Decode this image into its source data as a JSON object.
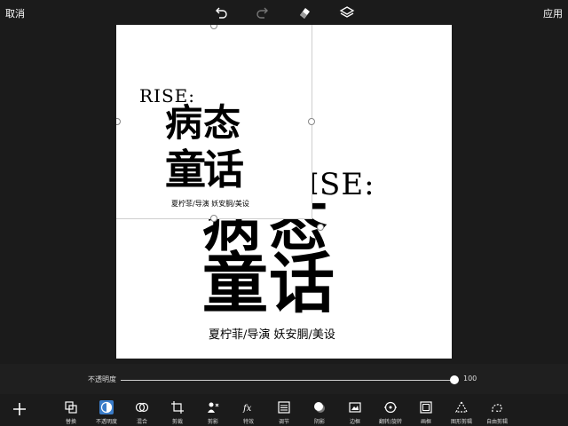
{
  "topbar": {
    "cancel_label": "取消",
    "apply_label": "应用",
    "icons": [
      "undo-icon",
      "redo-icon",
      "eraser-icon",
      "layers-icon"
    ]
  },
  "artwork": {
    "rise": "RISE:",
    "char1": "病",
    "char2": "态",
    "char3": "童",
    "char4": "话",
    "credit": "夏柠菲/导演   妖安胴/美设"
  },
  "opacity": {
    "label": "不透明度",
    "value": 100,
    "value_text": "100",
    "fraction": 1.0
  },
  "toolbar": {
    "add_icon": "plus-icon",
    "tools": [
      {
        "label": "替换",
        "icon": "replace-icon",
        "active": false
      },
      {
        "label": "不透明度",
        "icon": "opacity-icon",
        "active": true
      },
      {
        "label": "混合",
        "icon": "blend-icon",
        "active": false
      },
      {
        "label": "剪裁",
        "icon": "crop-icon",
        "active": false
      },
      {
        "label": "剪影",
        "icon": "silhouette-icon",
        "active": false
      },
      {
        "label": "特效",
        "icon": "fx-icon",
        "active": false
      },
      {
        "label": "调节",
        "icon": "adjust-icon",
        "active": false
      },
      {
        "label": "阴影",
        "icon": "shadow-icon",
        "active": false
      },
      {
        "label": "边框",
        "icon": "border-icon",
        "active": false
      },
      {
        "label": "翻转/旋转",
        "icon": "flip-rotate-icon",
        "active": false
      },
      {
        "label": "画框",
        "icon": "frame-icon",
        "active": false
      },
      {
        "label": "图形剪辑",
        "icon": "shape-crop-icon",
        "active": false
      },
      {
        "label": "自由剪辑",
        "icon": "free-crop-icon",
        "active": false
      }
    ]
  },
  "colors": {
    "background": "#1b1b1b",
    "accent": "#3a7cc8",
    "canvas": "#ffffff"
  }
}
